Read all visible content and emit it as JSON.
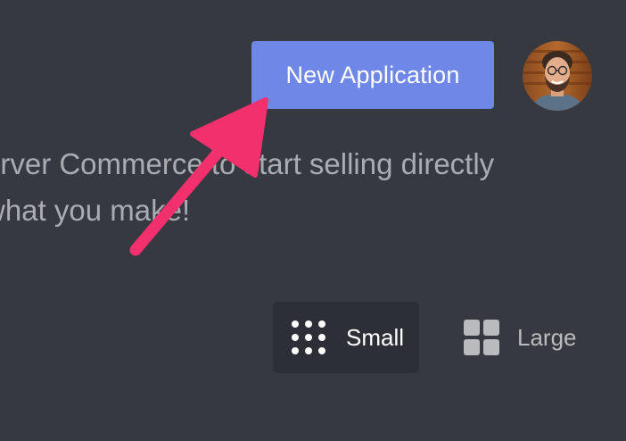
{
  "header": {
    "new_application_label": "New Application"
  },
  "description": {
    "line1": "erver Commerce to start selling directly",
    "line2": " what you make!"
  },
  "view_toggle": {
    "small_label": "Small",
    "large_label": "Large",
    "selected": "Small"
  },
  "colors": {
    "background": "#36393f",
    "button": "#6f87e6",
    "arrow": "#f2306e",
    "selected_toggle_bg": "#2c2f35",
    "muted_text": "#a9acb0"
  },
  "icons": {
    "small_view": "dots-grid-icon",
    "large_view": "squares-grid-icon",
    "annotation": "arrow-icon"
  }
}
